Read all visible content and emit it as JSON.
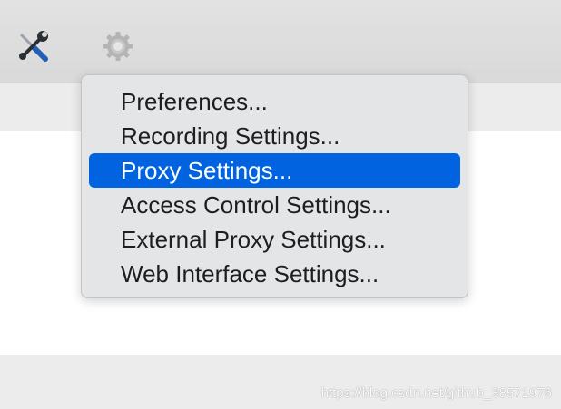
{
  "toolbar": {
    "tools_icon": "wrench-screwdriver-icon",
    "settings_icon": "gear-icon"
  },
  "menu": {
    "items": [
      {
        "label": "Preferences...",
        "active": false
      },
      {
        "label": "Recording Settings...",
        "active": false
      },
      {
        "label": "Proxy Settings...",
        "active": true
      },
      {
        "label": "Access Control Settings...",
        "active": false
      },
      {
        "label": "External Proxy Settings...",
        "active": false
      },
      {
        "label": "Web Interface Settings...",
        "active": false
      }
    ]
  },
  "watermark": "https://blog.csdn.net/github_38571976",
  "colors": {
    "highlight": "#0163e0",
    "menu_background": "#e4e5e7",
    "toolbar_background": "#dedede"
  }
}
